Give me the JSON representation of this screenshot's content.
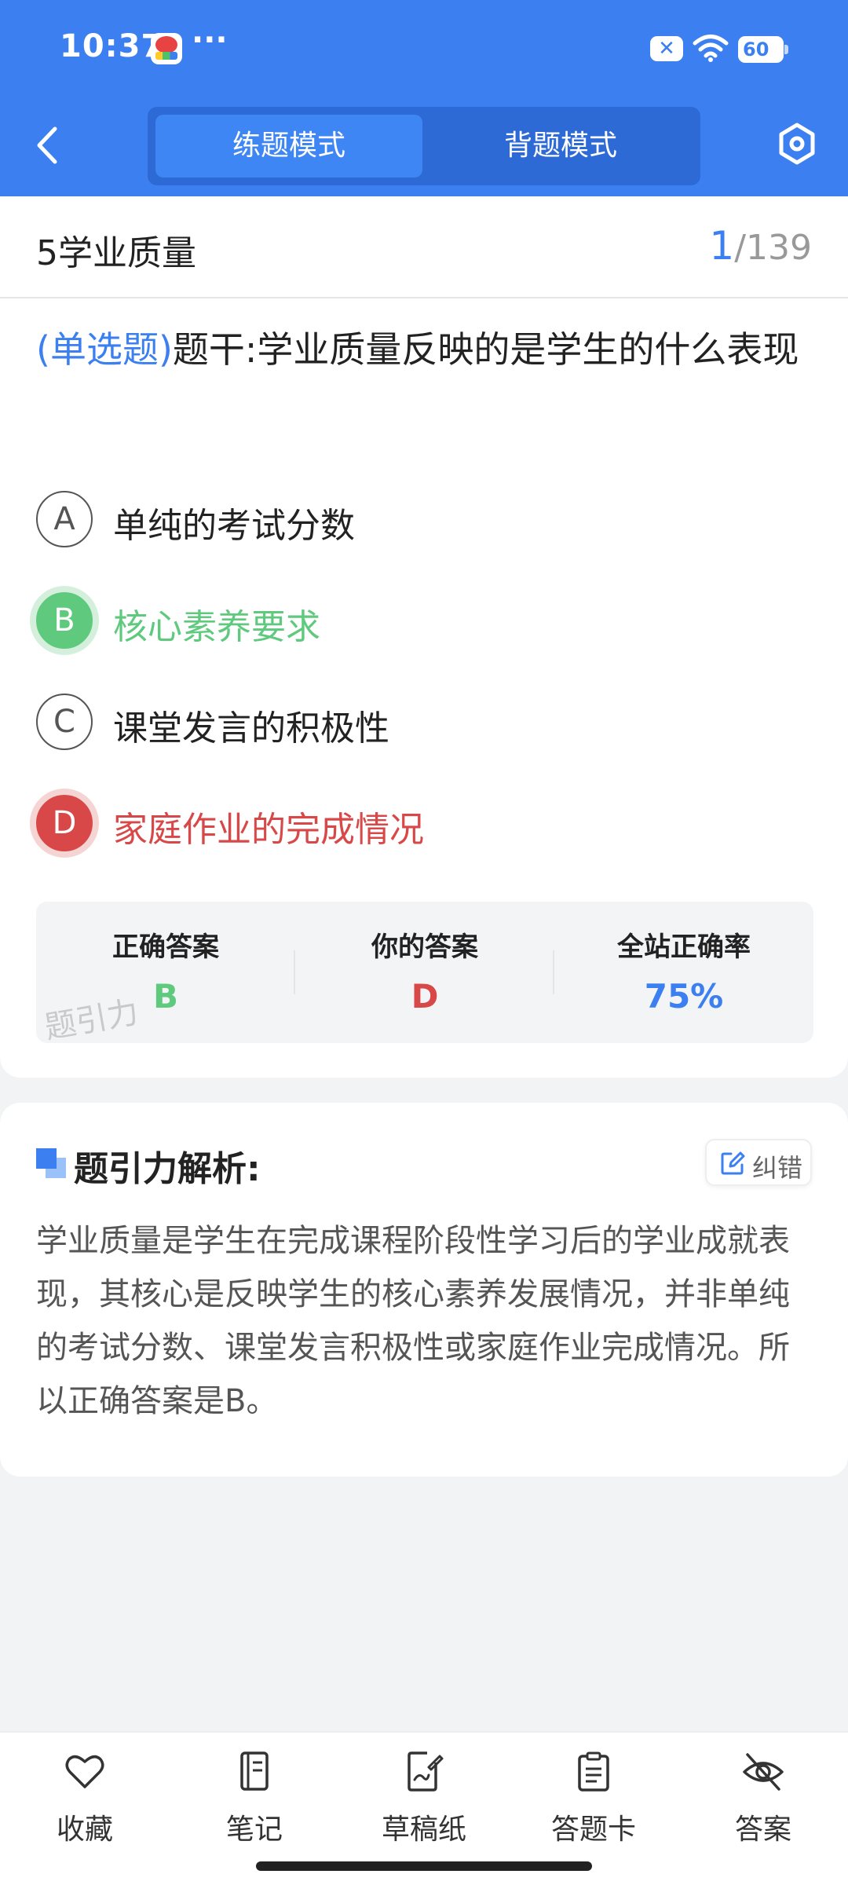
{
  "status_bar": {
    "time": "10:37",
    "more": "···",
    "battery": "60"
  },
  "header": {
    "tabs": [
      {
        "label": "练题模式",
        "active": true
      },
      {
        "label": "背题模式",
        "active": false
      }
    ],
    "back_icon": "chevron-left-icon",
    "settings_icon": "hexagon-settings-icon"
  },
  "chapter": {
    "title": "5学业质量",
    "current": "1",
    "total": "/139"
  },
  "question": {
    "type_label": "(单选题)",
    "stem": "题干:学业质量反映的是学生的什么表现"
  },
  "options": [
    {
      "letter": "A",
      "text": "单纯的考试分数",
      "state": "normal"
    },
    {
      "letter": "B",
      "text": "核心素养要求",
      "state": "correct"
    },
    {
      "letter": "C",
      "text": "课堂发言的积极性",
      "state": "normal"
    },
    {
      "letter": "D",
      "text": "家庭作业的完成情况",
      "state": "wrong"
    }
  ],
  "result": {
    "correct_label": "正确答案",
    "correct_value": "B",
    "yours_label": "你的答案",
    "yours_value": "D",
    "rate_label": "全站正确率",
    "rate_value": "75%",
    "watermark": "题引力"
  },
  "analysis": {
    "title": "题引力解析:",
    "report_label": "纠错",
    "text": "学业质量是学生在完成课程阶段性学习后的学业成就表现，其核心是反映学生的核心素养发展情况，并非单纯的考试分数、课堂发言积极性或家庭作业完成情况。所以正确答案是B。"
  },
  "bottom_nav": [
    {
      "label": "收藏",
      "icon": "heart-icon"
    },
    {
      "label": "笔记",
      "icon": "notebook-icon"
    },
    {
      "label": "草稿纸",
      "icon": "draft-paper-icon"
    },
    {
      "label": "答题卡",
      "icon": "answer-card-icon"
    },
    {
      "label": "答案",
      "icon": "eye-off-icon"
    }
  ],
  "colors": {
    "primary": "#3b7ff0",
    "correct": "#5fc97e",
    "wrong": "#d94848"
  }
}
